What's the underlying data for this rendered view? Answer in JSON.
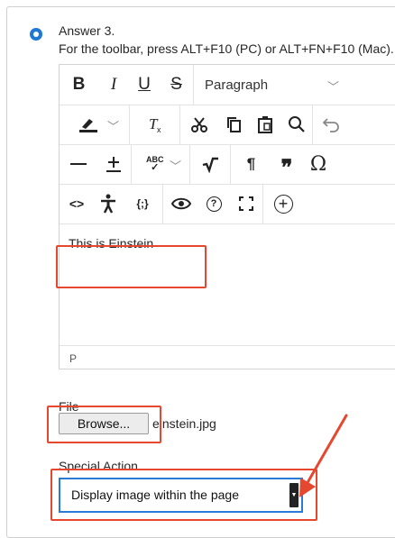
{
  "answer": {
    "label": "Answer 3.",
    "toolbar_hint": "For the toolbar, press ALT+F10 (PC) or ALT+FN+F10 (Mac)."
  },
  "editor": {
    "toolbar": {
      "row1": {
        "bold": "B",
        "italic": "I",
        "underline": "U",
        "strikethrough": "S",
        "format_select": "Paragraph"
      },
      "row2": {
        "highlight": "highlighter-icon",
        "clear_format": "clear-formatting-icon",
        "cut": "scissors-icon",
        "copy": "copy-icon",
        "paste": "paste-icon",
        "find": "search-icon",
        "undo": "undo-icon"
      },
      "row3": {
        "hr": "horizontal-line-icon",
        "plus_minus": "plus-minus-icon",
        "spellcheck": "ABC",
        "math": "square-root-icon",
        "pilcrow": "¶",
        "quote": "❞",
        "special_char": "Ω"
      },
      "row4": {
        "code": "<>",
        "accessibility": "accessibility-icon",
        "source": "{;}",
        "preview": "eye-icon",
        "help": "?",
        "fullscreen": "fullscreen-icon",
        "insert": "+"
      }
    },
    "content_text": "This is Einstein",
    "status_path": "P"
  },
  "file": {
    "label": "File",
    "browse_label": "Browse...",
    "filename": "einstein.jpg"
  },
  "special_action": {
    "label": "Special Action",
    "selected": "Display image within the page"
  },
  "colors": {
    "highlight": "#e5472f",
    "accent": "#1f78d1"
  }
}
